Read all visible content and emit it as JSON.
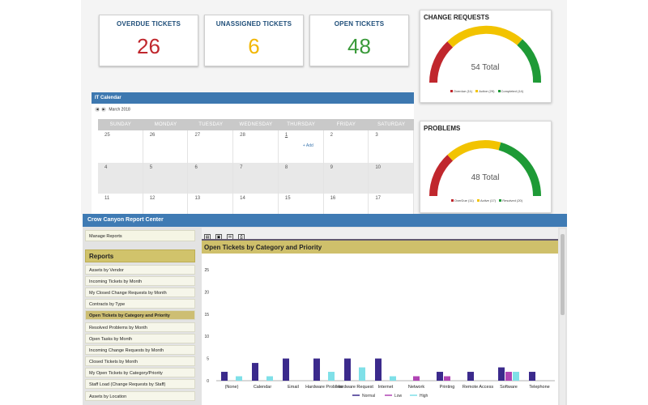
{
  "tiles": [
    {
      "title": "OVERDUE TICKETS",
      "value": "26",
      "color": "#c0272d"
    },
    {
      "title": "UNASSIGNED TICKETS",
      "value": "6",
      "color": "#f2b705"
    },
    {
      "title": "OPEN TICKETS",
      "value": "48",
      "color": "#3a9a3a"
    }
  ],
  "change_requests": {
    "title": "CHANGE REQUESTS",
    "total_label": "54 Total",
    "legend": [
      {
        "label": "Overdue (11)",
        "color": "#c0272d"
      },
      {
        "label": "Active (29)",
        "color": "#f2c300"
      },
      {
        "label": "Completed (14)",
        "color": "#1e9a36"
      }
    ]
  },
  "problems": {
    "title": "PROBLEMS",
    "total_label": "48 Total",
    "legend": [
      {
        "label": "OverDue (11)",
        "color": "#c0272d"
      },
      {
        "label": "Active (17)",
        "color": "#f2c300"
      },
      {
        "label": "Resolved (20)",
        "color": "#1e9a36"
      }
    ]
  },
  "calendar": {
    "title": "IT Calendar",
    "month": "March 2018",
    "days": [
      "SUNDAY",
      "MONDAY",
      "TUESDAY",
      "WEDNESDAY",
      "THURSDAY",
      "FRIDAY",
      "SATURDAY"
    ],
    "weeks": [
      [
        "25",
        "26",
        "27",
        "28",
        "1",
        "2",
        "3"
      ],
      [
        "4",
        "5",
        "6",
        "7",
        "8",
        "9",
        "10"
      ],
      [
        "11",
        "12",
        "13",
        "14",
        "15",
        "16",
        "17"
      ]
    ],
    "add_label": "+ Add"
  },
  "report_center": {
    "title": "Crow Canyon Report Center",
    "manage_label": "Manage Reports",
    "reports_heading": "Reports",
    "items": [
      "Assets by Vendor",
      "Incoming Tickets by Month",
      "My Closed Change Requests by Month",
      "Contracts by Type",
      "Open Tickets by Category and Priority",
      "Resolved Problems by Month",
      "Open Tasks by Month",
      "Incoming Change Requests by Month",
      "Closed Tickets by Month",
      "My Open Tickets by Category/Priority",
      "Staff Load (Change Requests by Staff)",
      "Assets by Location"
    ],
    "selected_index": 4,
    "toolbar_icons": [
      "pdf-icon",
      "image-icon",
      "email-icon",
      "print-icon"
    ],
    "report_title": "Open Tickets by Category and Priority"
  },
  "chart_data": {
    "type": "bar",
    "categories": [
      "(None)",
      "Calendar",
      "Email",
      "Hardware Problem",
      "Hardware Request",
      "Internet",
      "Network",
      "Printing",
      "Remote Access",
      "Software",
      "Telephone"
    ],
    "series": [
      {
        "name": "Normal",
        "color": "#3b2a8c",
        "values": [
          2,
          4,
          5,
          5,
          5,
          5,
          0,
          2,
          2,
          3,
          2
        ]
      },
      {
        "name": "Low",
        "color": "#b044b4",
        "values": [
          0,
          0,
          0,
          0,
          0,
          0,
          1,
          1,
          0,
          2,
          0
        ]
      },
      {
        "name": "High",
        "color": "#7fe0e8",
        "values": [
          1,
          1,
          0,
          2,
          3,
          1,
          0,
          0,
          0,
          2,
          0
        ]
      }
    ],
    "yticks": [
      0,
      5,
      10,
      15,
      20,
      25
    ],
    "ylim": [
      0,
      25
    ],
    "legend_position": "bottom"
  }
}
